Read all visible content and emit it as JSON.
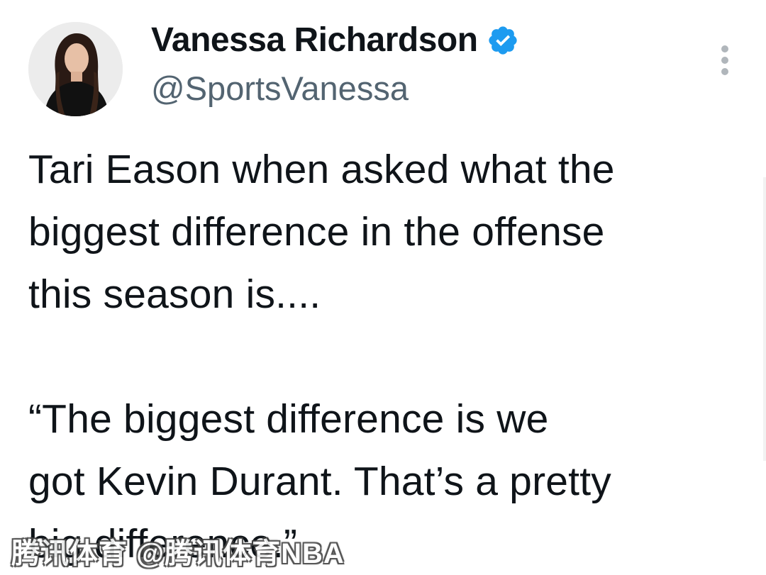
{
  "tweet": {
    "author": {
      "name": "Vanessa Richardson",
      "handle": "@SportsVanessa",
      "verified": true
    },
    "paragraphs": [
      "Tari Eason when asked what the\nbiggest difference in the offense\nthis season is....",
      "“The biggest difference is we\ngot Kevin Durant. That’s a pretty\nbig difference.”"
    ],
    "more_icon": "more-vertical-icon",
    "verified_icon": "verified-badge-icon"
  },
  "watermark": "腾讯体育 @腾讯体育NBA",
  "colors": {
    "text": "#0f1419",
    "handle": "#536471",
    "verified": "#1d9bf0",
    "icon_gray": "#b0b6bb"
  }
}
